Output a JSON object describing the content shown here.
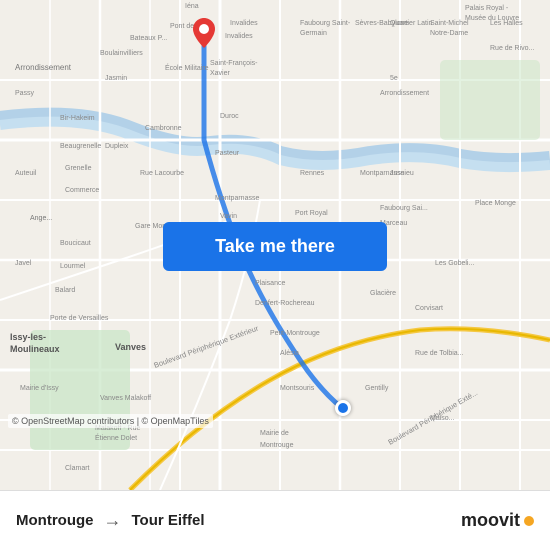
{
  "map": {
    "alt": "Map of Paris showing route from Montrouge to Tour Eiffel",
    "copyright": "© OpenStreetMap contributors | © OpenMapTiles"
  },
  "button": {
    "label": "Take me there"
  },
  "bottom_bar": {
    "from": "Montrouge",
    "arrow": "→",
    "to": "Tour Eiffel",
    "brand": "moovit"
  }
}
